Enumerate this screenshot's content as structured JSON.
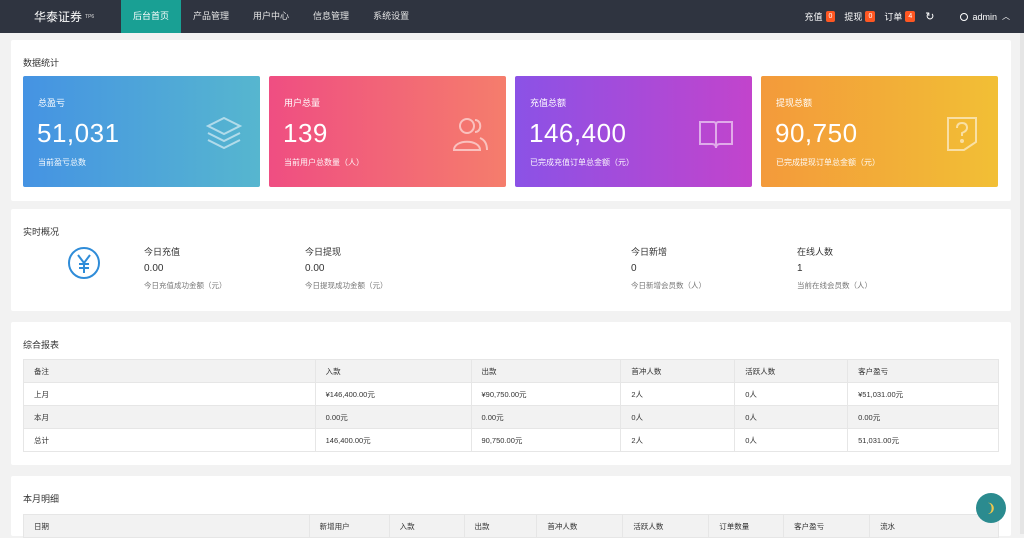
{
  "brand": {
    "name": "华泰证券",
    "version": "TP6"
  },
  "nav": [
    {
      "label": "后台首页",
      "active": true
    },
    {
      "label": "产品管理",
      "active": false
    },
    {
      "label": "用户中心",
      "active": false
    },
    {
      "label": "信息管理",
      "active": false
    },
    {
      "label": "系统设置",
      "active": false
    }
  ],
  "topright": {
    "recharge_label": "充值",
    "recharge_count": "0",
    "withdraw_label": "提现",
    "withdraw_count": "0",
    "order_label": "订单",
    "order_count": "4",
    "user": "admin"
  },
  "stats": {
    "title": "数据统计",
    "cards": [
      {
        "title": "总盈亏",
        "value": "51,031",
        "desc": "当前盈亏总数",
        "icon": "layers-icon"
      },
      {
        "title": "用户总量",
        "value": "139",
        "desc": "当前用户总数量（人）",
        "icon": "users-icon"
      },
      {
        "title": "充值总额",
        "value": "146,400",
        "desc": "已完成充值订单总金额（元）",
        "icon": "book-icon"
      },
      {
        "title": "提现总额",
        "value": "90,750",
        "desc": "已完成提现订单总金额（元）",
        "icon": "question-doc-icon"
      }
    ]
  },
  "realtime": {
    "title": "实时概况",
    "items": [
      {
        "title": "今日充值",
        "value": "0.00",
        "desc": "今日充值成功金额（元）"
      },
      {
        "title": "今日提现",
        "value": "0.00",
        "desc": "今日提现成功金额（元）"
      },
      {
        "title": "今日新增",
        "value": "0",
        "desc": "今日新增会员数（人）"
      },
      {
        "title": "在线人数",
        "value": "1",
        "desc": "当前在线会员数（人）"
      }
    ]
  },
  "report": {
    "title": "综合报表",
    "headers": [
      "备注",
      "入款",
      "出款",
      "首冲人数",
      "活跃人数",
      "客户盈亏"
    ],
    "rows": [
      [
        "上月",
        "¥146,400.00元",
        "¥90,750.00元",
        "2人",
        "0人",
        "¥51,031.00元"
      ],
      [
        "本月",
        "0.00元",
        "0.00元",
        "0人",
        "0人",
        "0.00元"
      ],
      [
        "总计",
        "146,400.00元",
        "90,750.00元",
        "2人",
        "0人",
        "51,031.00元"
      ]
    ]
  },
  "monthly": {
    "title": "本月明细",
    "headers": [
      "日期",
      "新增用户",
      "入款",
      "出款",
      "首冲人数",
      "活跃人数",
      "订单数量",
      "客户盈亏",
      "流水"
    ]
  },
  "colors": {
    "topbar": "#2f3440",
    "active": "#19a094",
    "badge": "#ff5722"
  }
}
